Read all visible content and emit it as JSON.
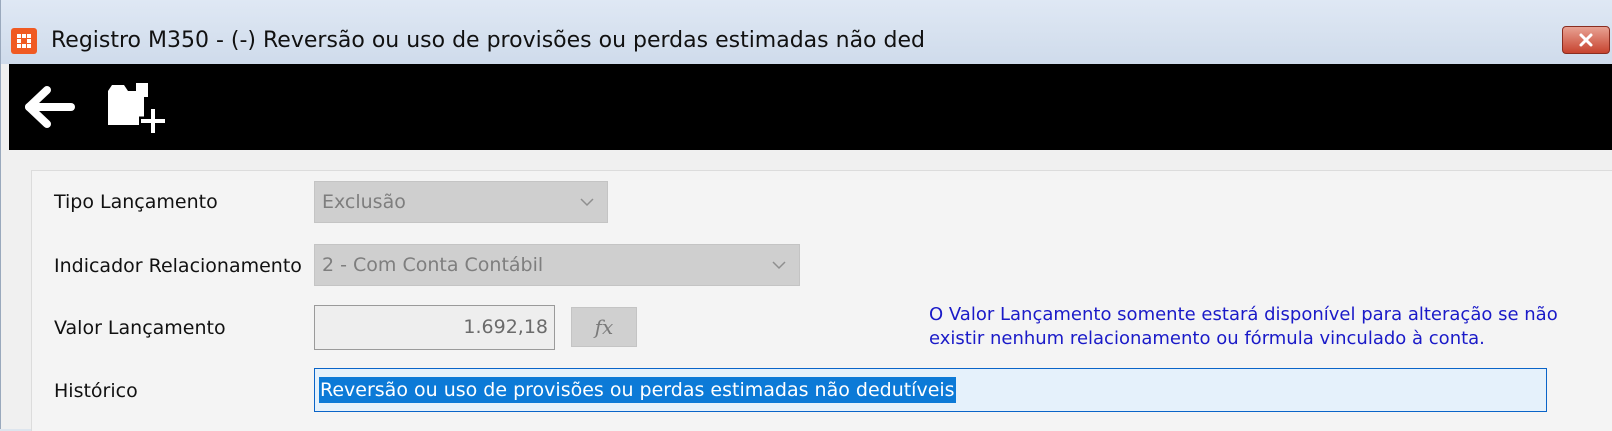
{
  "window": {
    "title": "Registro M350 - (-) Reversão ou uso de provisões ou perdas estimadas não ded",
    "close_icon": "close-icon"
  },
  "toolbar": {
    "back_icon": "arrow-left-icon",
    "new_icon": "folder-add-icon"
  },
  "form": {
    "tipo_label": "Tipo Lançamento",
    "tipo_value": "Exclusão",
    "indicador_label": "Indicador Relacionamento",
    "indicador_value": "2 - Com Conta Contábil",
    "valor_label": "Valor Lançamento",
    "valor_value": "1.692,18",
    "fx_label": "fx",
    "info_text": "O Valor Lançamento somente estará disponível para alteração se não existir nenhum relacionamento ou fórmula vinculado à conta.",
    "historico_label": "Histórico",
    "historico_value": "Reversão ou uso de provisões ou perdas estimadas não dedutíveis"
  },
  "colors": {
    "toolbar_bg": "#000000",
    "info_text": "#1a1ac8",
    "selection": "#0c7ad7",
    "app_icon": "#f05a22",
    "close_button": "#c7432e"
  }
}
